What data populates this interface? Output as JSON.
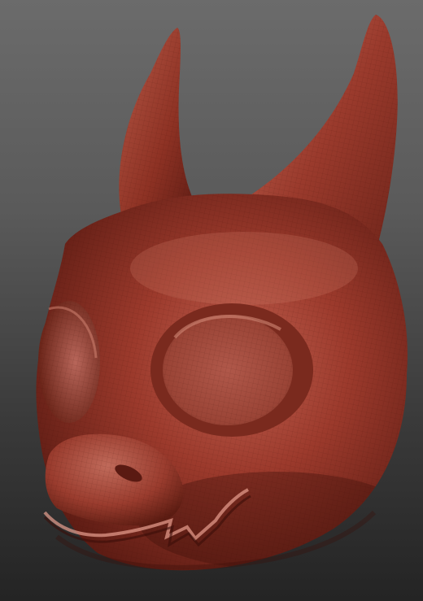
{
  "scene": {
    "subject": "sculpted-creature-head-mask",
    "background_top_color": "#6b6b6b",
    "background_bottom_color": "#242424",
    "material_color": "#9a3a2c",
    "material_highlight": "#c86a58",
    "material_shadow": "#4a1610",
    "wireframe_visible": true
  }
}
